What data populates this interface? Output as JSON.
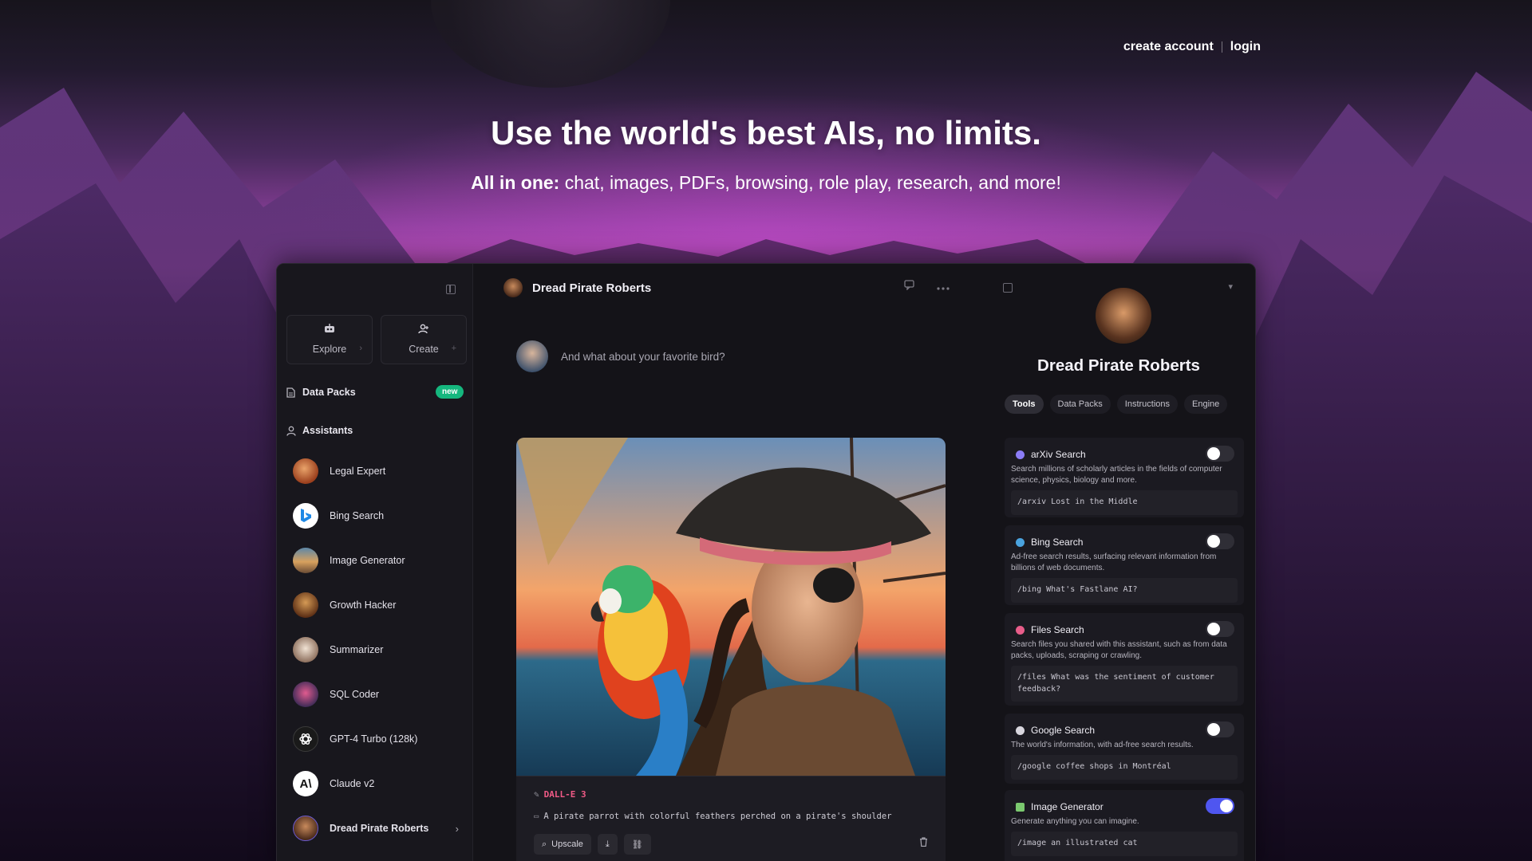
{
  "nav": {
    "create_account": "create account",
    "login": "login"
  },
  "hero": {
    "title": "Use the world's best AIs, no limits.",
    "subtitle_bold": "All in one:",
    "subtitle_rest": " chat, images, PDFs, browsing, role play, research, and more!"
  },
  "sidebar": {
    "tiles": [
      {
        "label": "Explore",
        "icon": "robot-icon"
      },
      {
        "label": "Create",
        "icon": "user-plus-icon"
      }
    ],
    "data_packs": {
      "label": "Data Packs",
      "badge": "new"
    },
    "assistants_header": "Assistants",
    "assistants": [
      {
        "name": "Legal Expert",
        "color": "#b8542c"
      },
      {
        "name": "Bing Search",
        "color": "#ffffff"
      },
      {
        "name": "Image Generator",
        "color": "#8a6a4a"
      },
      {
        "name": "Growth Hacker",
        "color": "#a65a20"
      },
      {
        "name": "Summarizer",
        "color": "#d9c4b0"
      },
      {
        "name": "SQL Coder",
        "color": "#c2457a"
      },
      {
        "name": "GPT-4 Turbo (128k)",
        "color": "#1a1a1a"
      },
      {
        "name": "Claude v2",
        "color": "#ffffff"
      },
      {
        "name": "Dread Pirate Roberts",
        "color": "#7a4a30"
      }
    ]
  },
  "chat": {
    "title": "Dread Pirate Roberts",
    "user_message": "And what about your favorite bird?",
    "image_card": {
      "engine": "DALL-E 3",
      "prompt": "A pirate parrot with colorful feathers perched on a pirate's shoulder",
      "upscale_label": "Upscale"
    }
  },
  "panel": {
    "name": "Dread Pirate Roberts",
    "tabs": [
      "Tools",
      "Data Packs",
      "Instructions",
      "Engine"
    ],
    "tools": [
      {
        "name": "arXiv Search",
        "icon_color": "#8b7cf6",
        "description": "Search millions of scholarly articles in the fields of computer science, physics, biology and more.",
        "command": "/arxiv Lost in the Middle",
        "enabled": false
      },
      {
        "name": "Bing Search",
        "icon_color": "#4aa3df",
        "description": "Ad-free search results, surfacing relevant information from billions of web documents.",
        "command": "/bing What's Fastlane AI?",
        "enabled": false
      },
      {
        "name": "Files Search",
        "icon_color": "#e85d8a",
        "description": "Search files you shared with this assistant, such as from data packs, uploads, scraping or crawling.",
        "command": "/files What was the sentiment of customer feedback?",
        "enabled": false
      },
      {
        "name": "Google Search",
        "icon_color": "#d8d6de",
        "description": "The world's information, with ad-free search results.",
        "command": "/google coffee shops in Montréal",
        "enabled": false
      },
      {
        "name": "Image Generator",
        "icon_color": "#7bc96f",
        "description": "Generate anything you can imagine.",
        "command": "/image an illustrated cat",
        "enabled": true
      }
    ]
  }
}
